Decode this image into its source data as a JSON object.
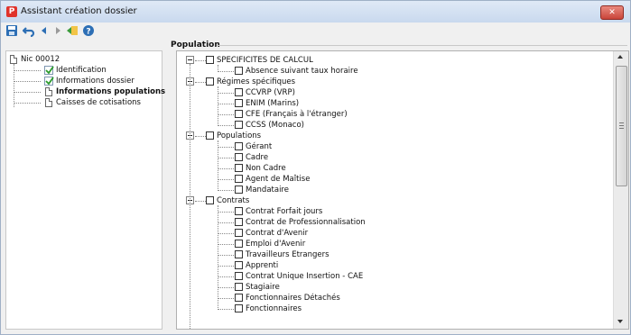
{
  "window": {
    "title": "Assistant création dossier",
    "app_icon_letter": "P",
    "close_label": "✕"
  },
  "toolbar": {
    "buttons": [
      "save-icon",
      "undo-icon",
      "back-icon",
      "forward-icon",
      "finish-icon",
      "help-icon"
    ]
  },
  "left_tree": {
    "root": "Nic 00012",
    "items": [
      {
        "label": "Identification",
        "status": "checked",
        "bold": false
      },
      {
        "label": "Informations dossier",
        "status": "checked",
        "bold": false
      },
      {
        "label": "Informations populations",
        "status": "current",
        "bold": true
      },
      {
        "label": "Caisses de cotisations",
        "status": "pending",
        "bold": false
      }
    ]
  },
  "section": {
    "title": "Population"
  },
  "tree": [
    {
      "label": "SPECIFICITES DE CALCUL",
      "children": [
        "Absence suivant taux horaire"
      ]
    },
    {
      "label": "Régimes spécifiques",
      "children": [
        "CCVRP (VRP)",
        "ENIM (Marins)",
        "CFE (Français à l'étranger)",
        "CCSS (Monaco)"
      ]
    },
    {
      "label": "Populations",
      "children": [
        "Gérant",
        "Cadre",
        "Non Cadre",
        "Agent de Maîtise",
        "Mandataire"
      ]
    },
    {
      "label": "Contrats",
      "children": [
        "Contrat Forfait jours",
        "Contrat de Professionnalisation",
        "Contrat d'Avenir",
        "Emploi d'Avenir",
        "Travailleurs Etrangers",
        "Apprenti",
        "Contrat Unique Insertion - CAE",
        "Stagiaire",
        "Fonctionnaires Détachés",
        "Fonctionnaires"
      ]
    }
  ]
}
